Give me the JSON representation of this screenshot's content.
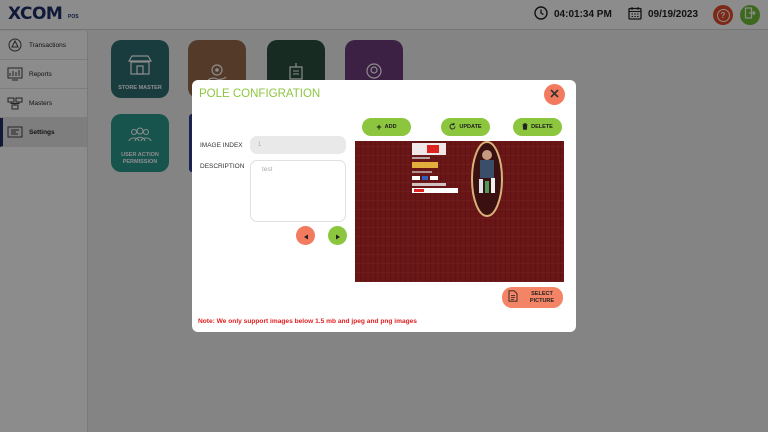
{
  "app": {
    "logo_text": "XCOM",
    "logo_sub": "POS"
  },
  "topbar": {
    "time": "04:01:34 PM",
    "date": "09/19/2023",
    "help_label": "?"
  },
  "sidebar": {
    "items": [
      {
        "label": "Transactions",
        "icon": "transactions-icon"
      },
      {
        "label": "Reports",
        "icon": "reports-icon"
      },
      {
        "label": "Masters",
        "icon": "masters-icon"
      },
      {
        "label": "Settings",
        "icon": "settings-icon",
        "active": true
      }
    ]
  },
  "tiles": {
    "store_master": "STORE MASTER",
    "user_action_permission": "USER ACTION PERMISSION"
  },
  "modal": {
    "title": "POLE CONFIGRATION",
    "image_index_label": "IMAGE INDEX",
    "image_index_value": "1",
    "description_label": "DESCRIPTION",
    "description_value": "test",
    "add_label": "ADD",
    "update_label": "UPDATE",
    "delete_label": "DELETE",
    "select_picture_label": "SELECT PICTURE",
    "note": "Note: We only support images below 1.5 mb and jpeg and png images"
  },
  "colors": {
    "accent_green": "#8cc63f",
    "accent_salmon": "#f27a5e",
    "brand_navy": "#1f2f66",
    "warning_red": "#e02020"
  }
}
